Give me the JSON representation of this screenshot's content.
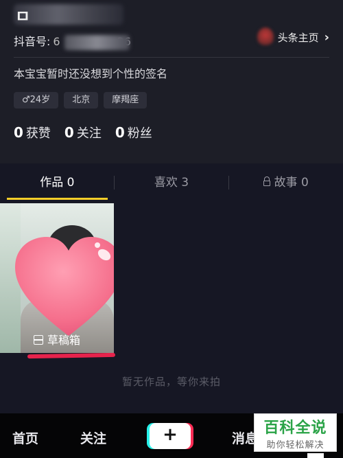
{
  "profile": {
    "name_visible": "ㅁ",
    "douyin_id_label": "抖音号:",
    "douyin_id_prefix": "6",
    "douyin_id_suffix": "36",
    "toutiao_label": "头条主页",
    "signature": "本宝宝暂时还没想到个性的签名",
    "tags": [
      "♂24岁",
      "北京",
      "摩羯座"
    ],
    "stats": [
      {
        "num": "0",
        "label": "获赞"
      },
      {
        "num": "0",
        "label": "关注"
      },
      {
        "num": "0",
        "label": "粉丝"
      }
    ]
  },
  "tabs": [
    {
      "label": "作品 0",
      "active": true
    },
    {
      "label": "喜欢 3",
      "active": false
    },
    {
      "label": "故事 0",
      "active": false,
      "icon": "lock-icon"
    }
  ],
  "draft": {
    "label": "草稿箱",
    "icon": "draft-box-icon"
  },
  "empty_text": "暂无作品，等你来拍",
  "bottom_nav": {
    "home": "首页",
    "follow": "关注",
    "plus": "+",
    "messages": "消息"
  },
  "watermark": {
    "title": "百科全说",
    "subtitle": "助你轻松解决"
  },
  "colors": {
    "accent": "#facf29",
    "annotation": "#e6234c",
    "background": "#161724"
  }
}
